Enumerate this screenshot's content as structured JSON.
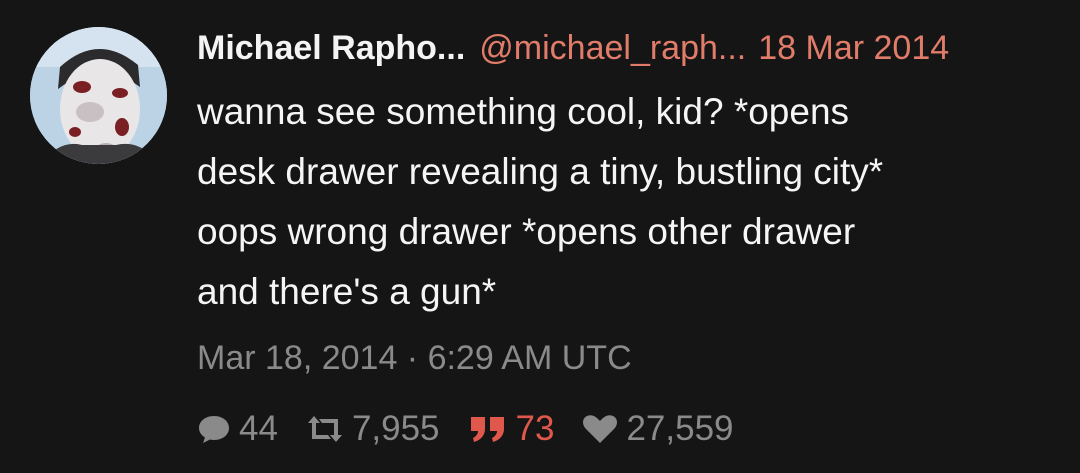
{
  "tweet": {
    "author": {
      "name": "Michael Rapho...",
      "handle": "@michael_raph...",
      "date": "18 Mar 2014"
    },
    "text_lines": [
      "wanna see something cool, kid? *opens",
      "desk drawer revealing a tiny, bustling city*",
      "oops wrong drawer *opens other drawer",
      "and there's a gun*"
    ],
    "timestamp": "Mar 18, 2014 · 6:29 AM UTC",
    "stats": {
      "replies": "44",
      "retweets": "7,955",
      "quotes": "73",
      "likes": "27,559"
    }
  },
  "icons": {
    "reply": "comment-bubble-icon",
    "retweet": "retweet-icon",
    "quote": "quote-icon",
    "like": "heart-icon"
  },
  "colors": {
    "background": "#151515",
    "text": "#f5f5f5",
    "accent": "#e27c6a",
    "muted": "#8a8a8a",
    "quote": "#e0584b"
  }
}
